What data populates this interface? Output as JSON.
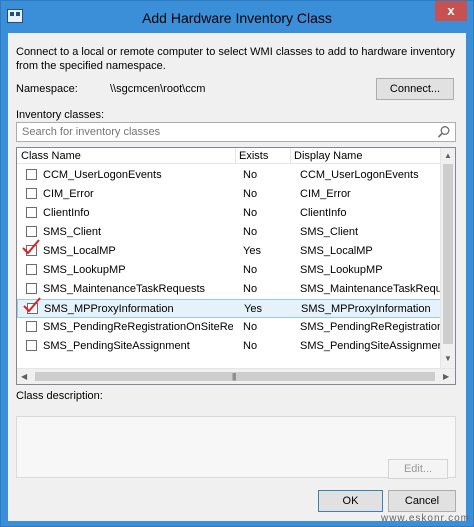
{
  "window": {
    "title": "Add Hardware Inventory Class",
    "close_glyph": "x"
  },
  "description": "Connect to a local or remote computer to select WMI classes to add to hardware inventory from the specified namespace.",
  "namespace": {
    "label": "Namespace:",
    "value": "\\\\sgcmcen\\root\\ccm",
    "connect_label": "Connect..."
  },
  "inventory": {
    "label": "Inventory classes:",
    "search_placeholder": "Search for inventory classes"
  },
  "table": {
    "columns": [
      "Class Name",
      "Exists",
      "Display Name"
    ],
    "rows": [
      {
        "name": "CCM_UserLogonEvents",
        "exists": "No",
        "display": "CCM_UserLogonEvents",
        "checked": false,
        "selected": false
      },
      {
        "name": "CIM_Error",
        "exists": "No",
        "display": "CIM_Error",
        "checked": false,
        "selected": false
      },
      {
        "name": "ClientInfo",
        "exists": "No",
        "display": "ClientInfo",
        "checked": false,
        "selected": false
      },
      {
        "name": "SMS_Client",
        "exists": "No",
        "display": "SMS_Client",
        "checked": false,
        "selected": false
      },
      {
        "name": "SMS_LocalMP",
        "exists": "Yes",
        "display": "SMS_LocalMP",
        "checked": true,
        "selected": false
      },
      {
        "name": "SMS_LookupMP",
        "exists": "No",
        "display": "SMS_LookupMP",
        "checked": false,
        "selected": false
      },
      {
        "name": "SMS_MaintenanceTaskRequests",
        "exists": "No",
        "display": "SMS_MaintenanceTaskReques",
        "checked": false,
        "selected": false
      },
      {
        "name": "SMS_MPProxyInformation",
        "exists": "Yes",
        "display": "SMS_MPProxyInformation",
        "checked": true,
        "selected": true
      },
      {
        "name": "SMS_PendingReRegistrationOnSiteReAssi",
        "exists": "No",
        "display": "SMS_PendingReRegistrationO",
        "checked": false,
        "selected": false
      },
      {
        "name": "SMS_PendingSiteAssignment",
        "exists": "No",
        "display": "SMS_PendingSiteAssignment",
        "checked": false,
        "selected": false
      }
    ]
  },
  "class_description": {
    "label": "Class description:"
  },
  "buttons": {
    "edit": "Edit...",
    "ok": "OK",
    "cancel": "Cancel"
  },
  "watermark": "www.eskonr.com",
  "colors": {
    "titlebar": "#3a8fd8",
    "close": "#c75050",
    "check_red": "#e0201c",
    "selection": "#e5f1fb"
  },
  "icons": {
    "app": "hardware-inventory-icon",
    "search": "search-icon",
    "close": "close-icon"
  }
}
